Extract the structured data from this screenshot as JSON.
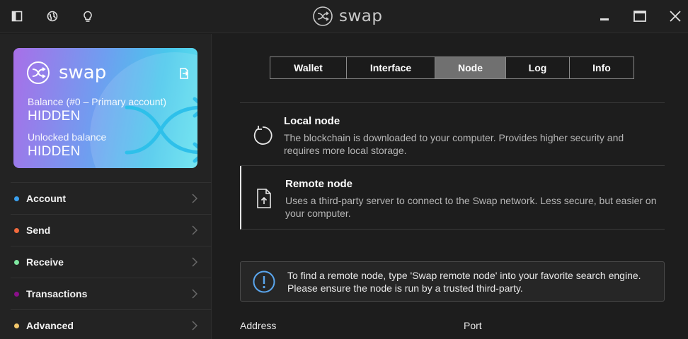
{
  "titlebar": {
    "app_name": "swap",
    "icons": [
      "sidebar-toggle-icon",
      "globe-icon",
      "lightbulb-icon"
    ],
    "window_controls": [
      "minimize-icon",
      "maximize-icon",
      "close-icon"
    ]
  },
  "card": {
    "logo_text": "swap",
    "balance_label": "Balance (#0 – Primary account)",
    "balance_value": "HIDDEN",
    "unlocked_label": "Unlocked balance",
    "unlocked_value": "HIDDEN",
    "gradient": [
      "#a86fe8",
      "#49c7ec",
      "#63e2ee"
    ]
  },
  "menu": {
    "items": [
      {
        "label": "Account",
        "color": "#3aa0ee"
      },
      {
        "label": "Send",
        "color": "#f26a3d"
      },
      {
        "label": "Receive",
        "color": "#7fe7a0"
      },
      {
        "label": "Transactions",
        "color": "#8a0f8a"
      },
      {
        "label": "Advanced",
        "color": "#f2c76b"
      }
    ]
  },
  "tabs": [
    {
      "label": "Wallet",
      "active": false
    },
    {
      "label": "Interface",
      "active": false
    },
    {
      "label": "Node",
      "active": true
    },
    {
      "label": "Log",
      "active": false
    },
    {
      "label": "Info",
      "active": false
    }
  ],
  "node_options": {
    "local": {
      "title": "Local node",
      "description": "The blockchain is downloaded to your computer. Provides higher security and requires more local storage.",
      "icon": "refresh-icon",
      "selected": false
    },
    "remote": {
      "title": "Remote node",
      "description": "Uses a third-party server to connect to the Swap network. Less secure, but easier on your computer.",
      "icon": "file-upload-icon",
      "selected": true
    }
  },
  "info": {
    "text": "To find a remote node, type 'Swap remote node' into your favorite search engine. Please ensure the node is run by a trusted third-party.",
    "icon": "info-circle-icon",
    "accent": "#5aa6ee"
  },
  "fields": {
    "address_label": "Address",
    "port_label": "Port"
  }
}
